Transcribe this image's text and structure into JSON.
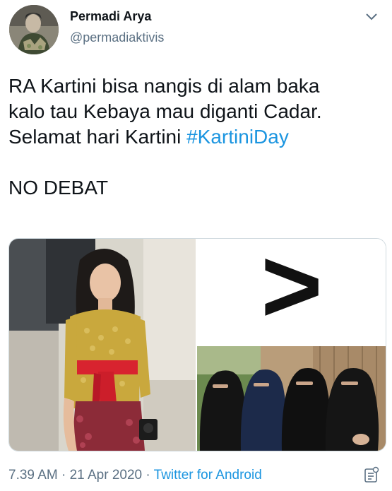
{
  "author": {
    "name": "Permadi Arya",
    "handle": "@permadiaktivis"
  },
  "icons": {
    "menu": "chevron-down-icon",
    "analytics": "analytics-icon"
  },
  "tweet": {
    "line1": "RA Kartini bisa nangis di alam baka",
    "line2": "kalo tau Kebaya mau diganti Cadar.",
    "line3_text": "Selamat hari Kartini ",
    "hashtag": "#KartiniDay",
    "line4": "NO DEBAT"
  },
  "media": {
    "comparison_symbol": ">"
  },
  "meta": {
    "time": "7.39 AM",
    "separator": " · ",
    "date": "21 Apr 2020",
    "separator2": " · ",
    "source": "Twitter for Android"
  },
  "colors": {
    "accent": "#1b95e0",
    "secondary_text": "#5b7083",
    "border": "#cfd9de"
  }
}
